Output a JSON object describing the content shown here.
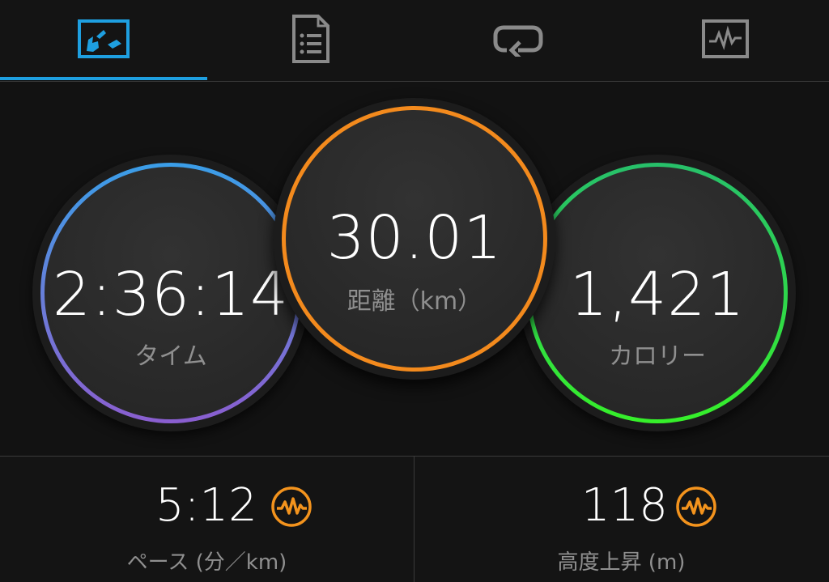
{
  "tabs": [
    {
      "name": "overview",
      "icon": "map-icon",
      "active": true
    },
    {
      "name": "details",
      "icon": "document-list-icon",
      "active": false
    },
    {
      "name": "laps",
      "icon": "loop-arrow-icon",
      "active": false
    },
    {
      "name": "charts",
      "icon": "activity-chart-icon",
      "active": false
    }
  ],
  "colors": {
    "accent": "#1e9fe0",
    "time_ring_top": "#3a9ee8",
    "time_ring_bottom": "#8a5ed0",
    "distance_ring": "#f38a1d",
    "calories_ring_top": "#27c06a",
    "calories_ring_bottom": "#36f02a",
    "zone_icon": "#f3931d"
  },
  "metrics": {
    "time": {
      "value": "2:36:14",
      "label": "タイム"
    },
    "distance": {
      "value": "30.01",
      "label": "距離（km）"
    },
    "calories": {
      "value": "1,421",
      "label": "カロリー"
    }
  },
  "stats": {
    "pace": {
      "value": "5:12",
      "label": "ペース (分／km)",
      "icon": "heart-rate-zone-icon"
    },
    "elevation": {
      "value": "118",
      "label": "高度上昇 (m)",
      "icon": "heart-rate-zone-icon"
    }
  }
}
